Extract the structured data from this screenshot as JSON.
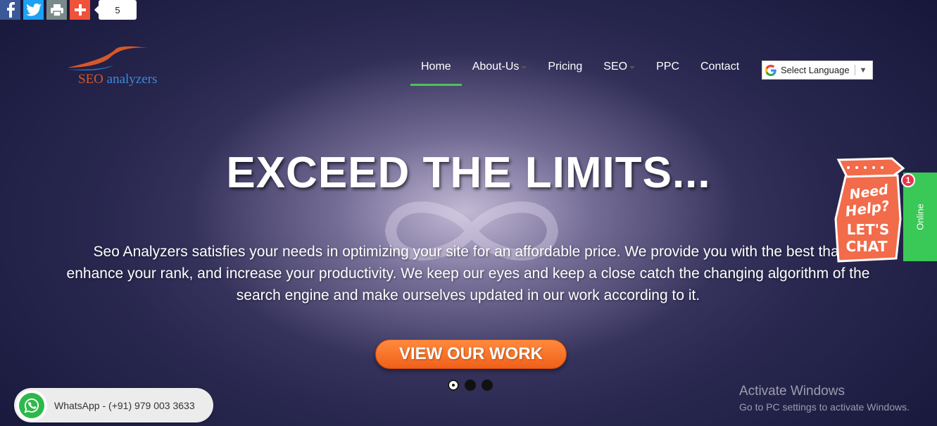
{
  "share": {
    "icons": [
      "facebook-icon",
      "twitter-icon",
      "print-icon",
      "add-icon"
    ],
    "count": "5"
  },
  "logo": {
    "part1": "SEO",
    "part2": "analyzers"
  },
  "nav": {
    "items": [
      {
        "label": "Home",
        "active": true
      },
      {
        "label": "About-Us",
        "dropdown": true
      },
      {
        "label": "Pricing"
      },
      {
        "label": "SEO",
        "dropdown": true
      },
      {
        "label": "PPC"
      },
      {
        "label": "Contact"
      }
    ]
  },
  "language": {
    "label": "Select Language",
    "arrow": "▼"
  },
  "hero": {
    "title": "EXCEED THE LIMITS...",
    "description": "Seo Analyzers satisfies your needs in optimizing your site for an affordable price. We provide you with the best that enhance your rank, and increase your productivity. We keep our eyes and keep a close catch the changing algorithm of the search engine and make ourselves updated in our work according to it.",
    "cta": "VIEW OUR WORK"
  },
  "slider": {
    "count": 3,
    "active": 0
  },
  "chat": {
    "line1": "Need",
    "line2": "Help?",
    "line3": "LET'S",
    "line4": "CHAT",
    "status": "Online",
    "notifications": "1"
  },
  "whatsapp": {
    "label": "WhatsApp - (+91) 979 003 3633"
  },
  "watermark": {
    "title": "Activate Windows",
    "subtitle": "Go to PC settings to activate Windows."
  },
  "colors": {
    "active_underline": "#4cc35a",
    "cta": "#f0601a",
    "online": "#3ac856",
    "whatsapp": "#2fb84a"
  }
}
